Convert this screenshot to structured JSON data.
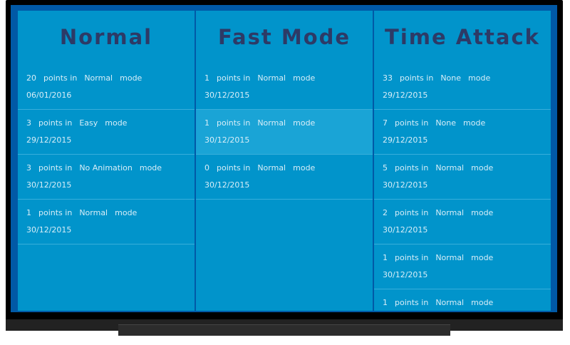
{
  "columns": [
    {
      "title": "Normal",
      "entries": [
        {
          "points": "20",
          "points_label": "points in",
          "mode": "Normal",
          "mode_label": "mode",
          "date": "06/01/2016"
        },
        {
          "points": "3",
          "points_label": "points in",
          "mode": "Easy",
          "mode_label": "mode",
          "date": "29/12/2015"
        },
        {
          "points": "3",
          "points_label": "points in",
          "mode": "No Animation",
          "mode_label": "mode",
          "date": "30/12/2015"
        },
        {
          "points": "1",
          "points_label": "points in",
          "mode": "Normal",
          "mode_label": "mode",
          "date": "30/12/2015"
        }
      ]
    },
    {
      "title": "Fast Mode",
      "entries": [
        {
          "points": "1",
          "points_label": "points in",
          "mode": "Normal",
          "mode_label": "mode",
          "date": "30/12/2015"
        },
        {
          "points": "1",
          "points_label": "points in",
          "mode": "Normal",
          "mode_label": "mode",
          "date": "30/12/2015"
        },
        {
          "points": "0",
          "points_label": "points in",
          "mode": "Normal",
          "mode_label": "mode",
          "date": "30/12/2015"
        }
      ]
    },
    {
      "title": "Time Attack",
      "entries": [
        {
          "points": "33",
          "points_label": "points in",
          "mode": "None",
          "mode_label": "mode",
          "date": "29/12/2015"
        },
        {
          "points": "7",
          "points_label": "points in",
          "mode": "None",
          "mode_label": "mode",
          "date": "29/12/2015"
        },
        {
          "points": "5",
          "points_label": "points in",
          "mode": "Normal",
          "mode_label": "mode",
          "date": "30/12/2015"
        },
        {
          "points": "2",
          "points_label": "points in",
          "mode": "Normal",
          "mode_label": "mode",
          "date": "30/12/2015"
        },
        {
          "points": "1",
          "points_label": "points in",
          "mode": "Normal",
          "mode_label": "mode",
          "date": "30/12/2015"
        },
        {
          "points": "1",
          "points_label": "points in",
          "mode": "Normal",
          "mode_label": "mode",
          "date": ""
        }
      ]
    }
  ],
  "colors": {
    "screen_bg": "#0159a6",
    "panel_bg": "#0194cb",
    "highlight_row": "#1aa4d6",
    "title_text": "#2d3a66",
    "row_text": "#d8eef8"
  }
}
